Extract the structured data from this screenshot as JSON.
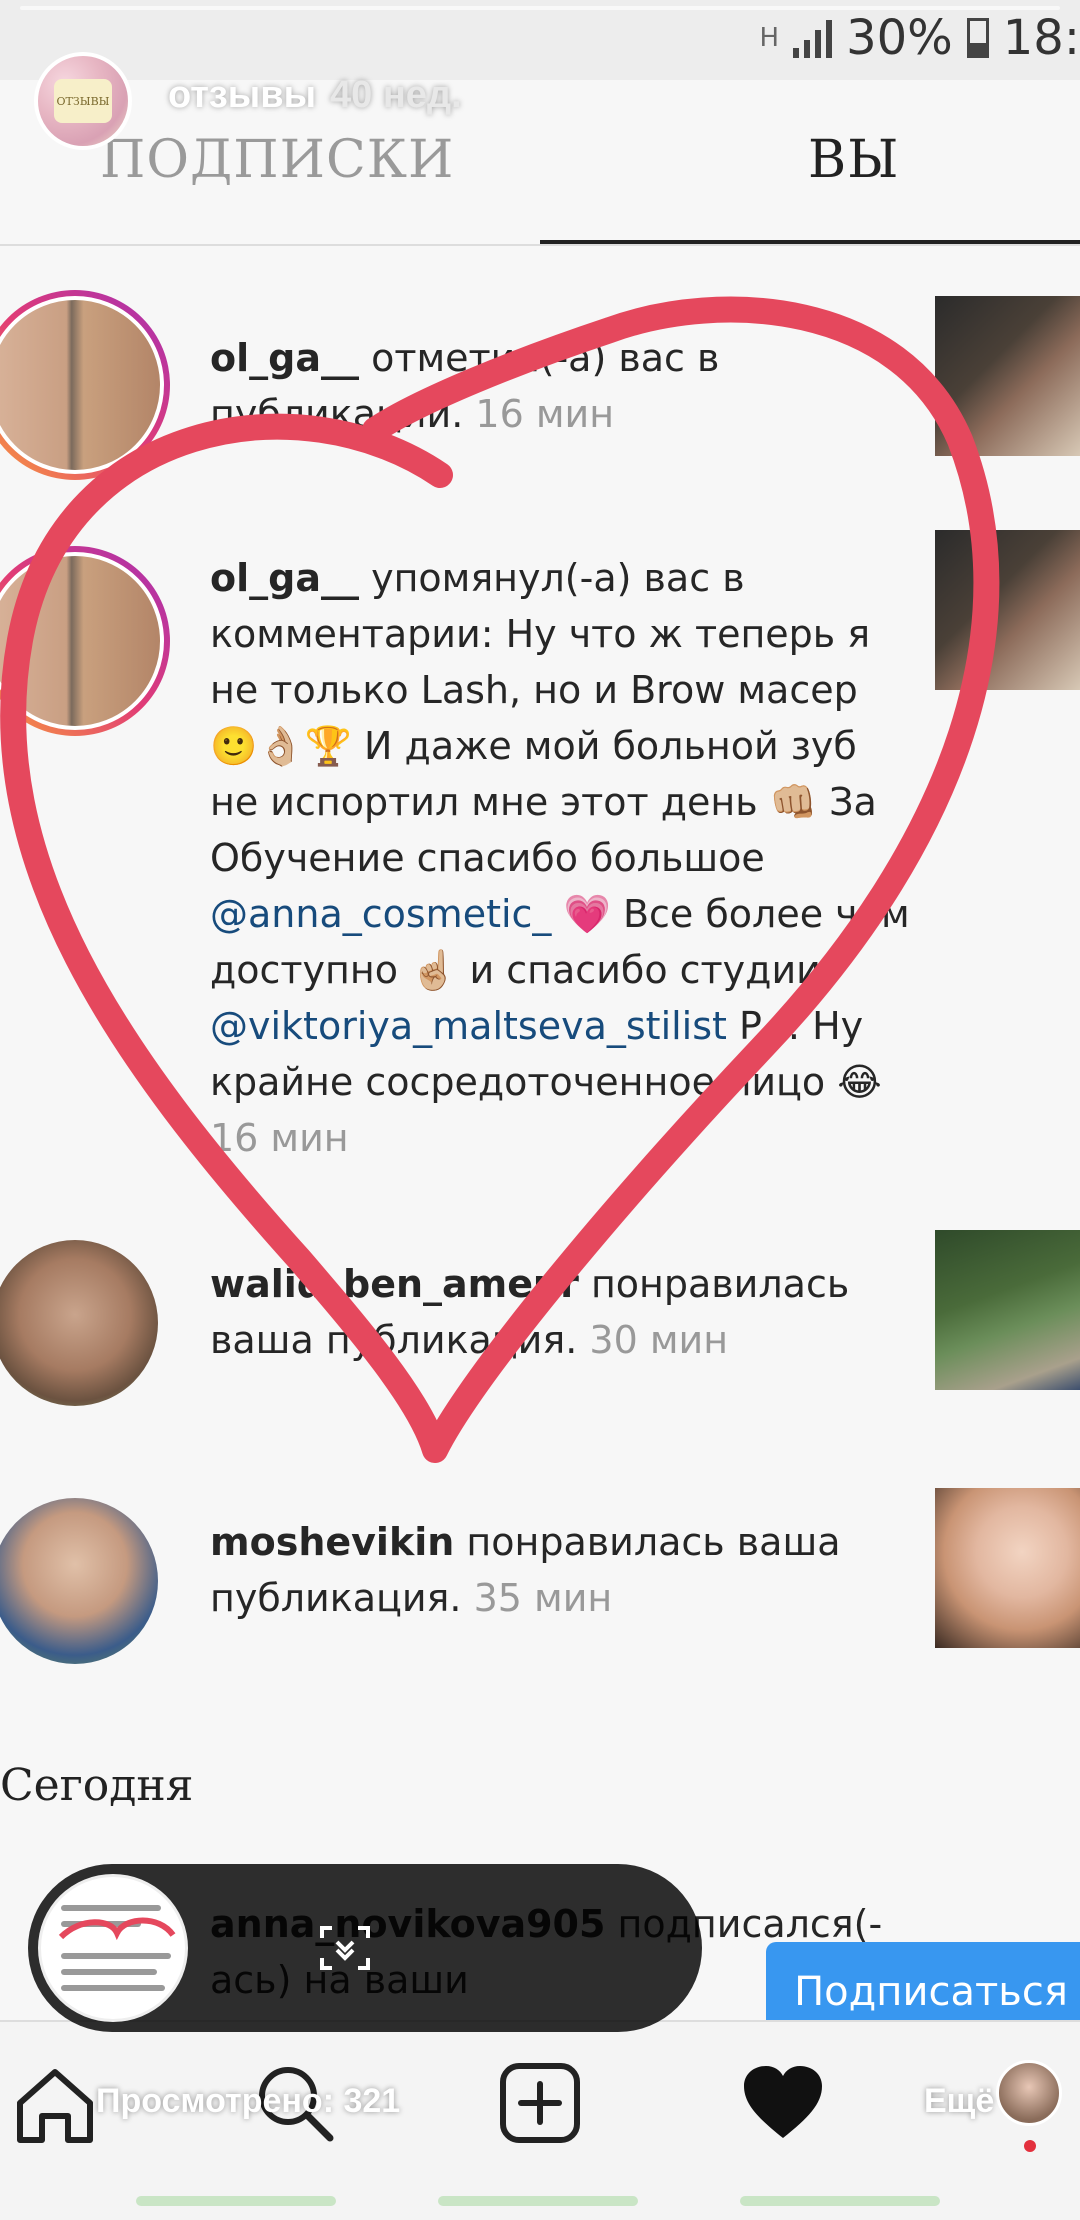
{
  "status_bar": {
    "network": "H",
    "battery": "30%",
    "time": "18:"
  },
  "story": {
    "account": "отзывы",
    "age": "40 нед.",
    "avatar_caption": "ОТЗЫВЫ"
  },
  "tabs": {
    "following": "ПОДПИСКИ",
    "you": "ВЫ",
    "active": "you"
  },
  "activity": [
    {
      "user": "ol_ga__",
      "pre": "отметил(-а) вас в",
      "rest": "публикации.",
      "time": "16 мин"
    },
    {
      "user": "ol_ga__",
      "action": "упомянул(-а) вас в комментарии: Ну что ж теперь я не только Lash, но и Brow масер",
      "emoji1": "🙂👌🏼🏆",
      "line2": "И даже мой больной зуб не испортил мне этот день",
      "emoji2": "👊🏼",
      "line3": "За Обучение спасибо большое",
      "mention1": "@anna_cosmetic_",
      "emoji3": "💗",
      "line4": "Все более чем доступно",
      "emoji4": "☝🏼",
      "line5": "и спасибо студии",
      "mention2": "@viktoriya_maltseva_stilist",
      "line6": "P.s. Ну крайне сосредоточенное лицо",
      "emoji5": "😂",
      "time": "16 мин"
    },
    {
      "user": "walid_ben_ameur",
      "action": "понравилась ваша публикация.",
      "time": "30 мин"
    },
    {
      "user": "moshevikin",
      "action": "понравилась ваша публикация.",
      "time": "35 мин"
    },
    {
      "user": "anna_novikova905",
      "action": "подписался(-ась) на ваши"
    }
  ],
  "section": {
    "today": "Сегодня"
  },
  "follow_button": "Подписаться",
  "viewer": {
    "label": "Просмотрено: 321",
    "more": "Ещё"
  },
  "nav": {
    "home": "home-icon",
    "search": "search-icon",
    "add": "plus-square-icon",
    "activity": "heart-icon",
    "profile": "profile-avatar"
  },
  "colors": {
    "accent": "#3897f0",
    "heart_stroke": "#e5485d",
    "mention": "#174b7c",
    "story_ring": "#e13c76"
  }
}
